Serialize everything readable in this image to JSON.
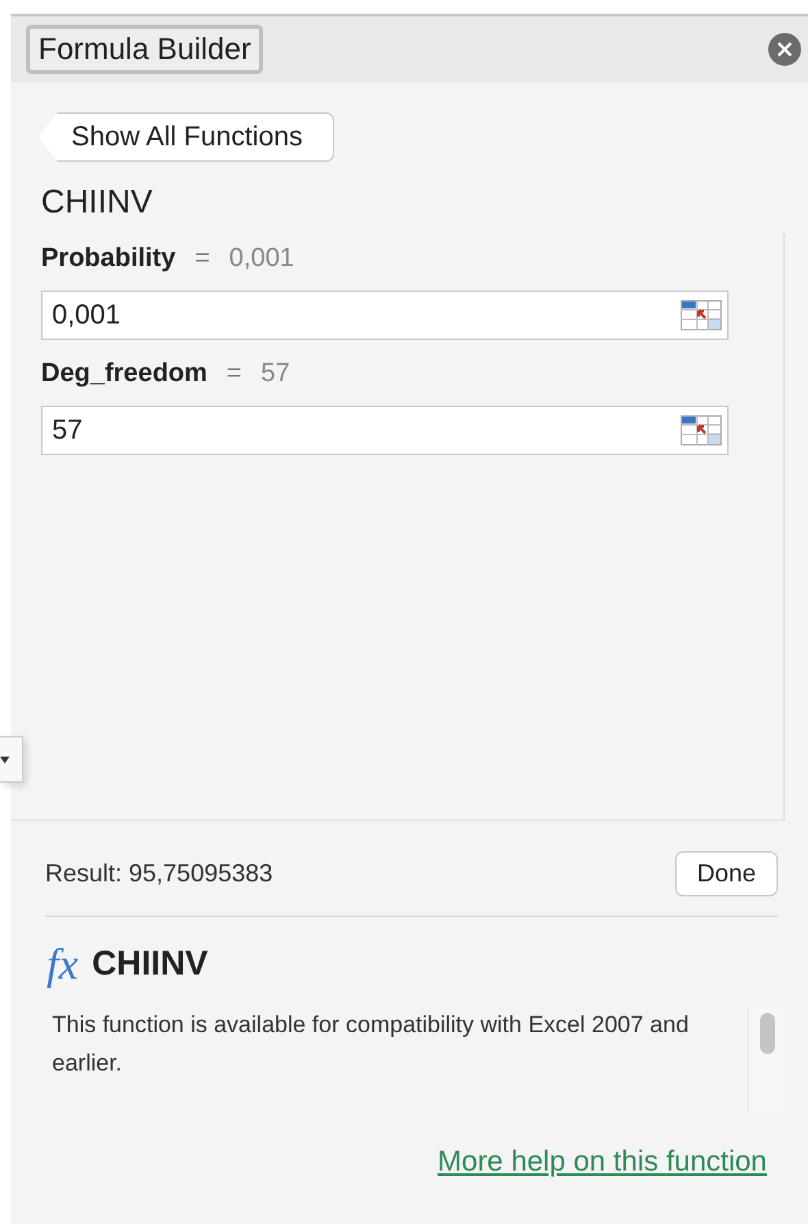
{
  "window": {
    "title": "Formula Builder"
  },
  "back_button": {
    "label": "Show All Functions"
  },
  "function_name": "CHIINV",
  "arguments": [
    {
      "name": "Probability",
      "equals": "=",
      "preview": "0,001",
      "value": "0,001"
    },
    {
      "name": "Deg_freedom",
      "equals": "=",
      "preview": "57",
      "value": "57"
    }
  ],
  "result": {
    "text": "Result: 95,75095383"
  },
  "done_button": {
    "label": "Done"
  },
  "help": {
    "fx": "fx",
    "title": "CHIINV",
    "description": "This function is available for compatibility with Excel 2007 and earlier.",
    "link": "More help on this function"
  }
}
